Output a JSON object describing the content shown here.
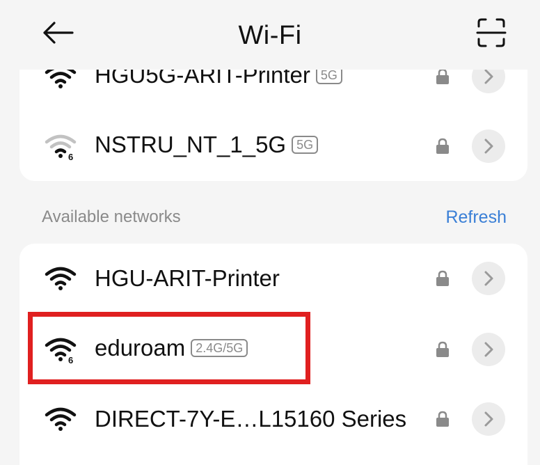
{
  "header": {
    "title": "Wi-Fi",
    "back_icon": "arrow-left-icon",
    "scan_icon": "scan-icon"
  },
  "saved_networks": [
    {
      "ssid": "HGU5G-ARIT-Printer",
      "band": "5G",
      "signal": "full",
      "wifi6": false,
      "locked": true
    },
    {
      "ssid": "NSTRU_NT_1_5G",
      "band": "5G",
      "signal": "weak",
      "wifi6": true,
      "locked": true
    }
  ],
  "available": {
    "label": "Available networks",
    "refresh_label": "Refresh",
    "networks": [
      {
        "ssid": "HGU-ARIT-Printer",
        "band": "",
        "signal": "full",
        "wifi6": false,
        "locked": true
      },
      {
        "ssid": "eduroam",
        "band": "2.4G/5G",
        "signal": "full",
        "wifi6": true,
        "locked": true,
        "highlighted": true
      },
      {
        "ssid": "DIRECT-7Y-E…L15160 Series",
        "band": "",
        "signal": "full",
        "wifi6": false,
        "locked": true
      }
    ]
  },
  "colors": {
    "accent": "#3a7fd6",
    "highlight": "#e02020",
    "background": "#f5f5f5"
  }
}
